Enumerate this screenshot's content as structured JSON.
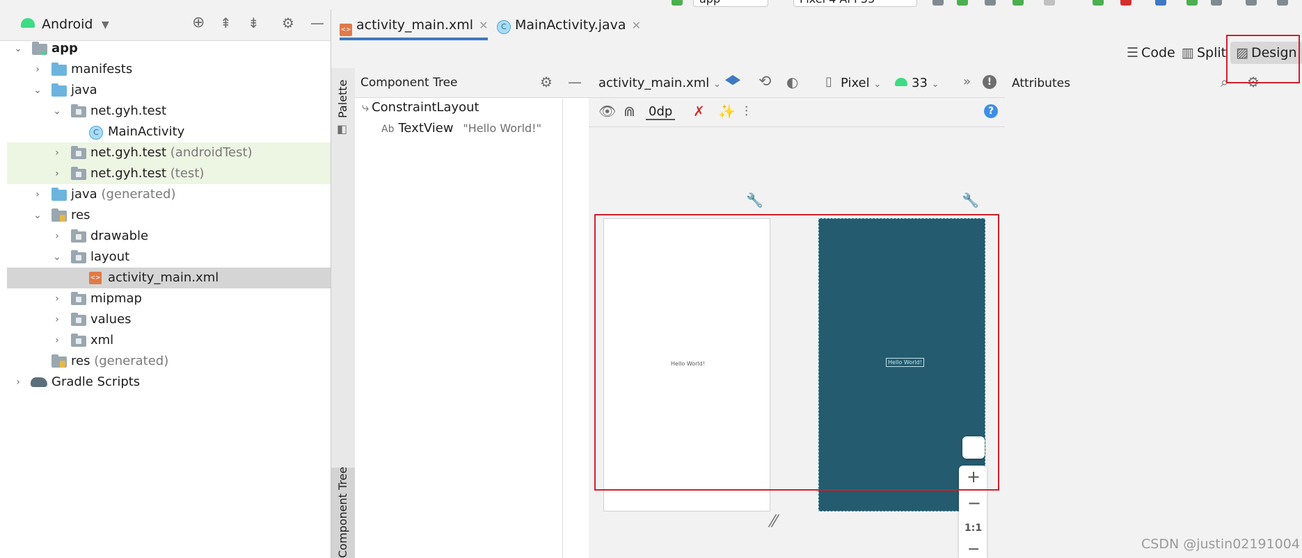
{
  "topbar": {
    "run_config": "app",
    "device": "Pixel 4 API 33"
  },
  "left_panel": {
    "view_selector": "Android",
    "tree": [
      {
        "label": "app",
        "bold": true
      },
      {
        "label": "manifests"
      },
      {
        "label": "java"
      },
      {
        "label": "net.gyh.test"
      },
      {
        "label": "MainActivity"
      },
      {
        "label": "net.gyh.test",
        "suffix": "(androidTest)"
      },
      {
        "label": "net.gyh.test",
        "suffix": "(test)"
      },
      {
        "label": "java",
        "suffix": "(generated)"
      },
      {
        "label": "res"
      },
      {
        "label": "drawable"
      },
      {
        "label": "layout"
      },
      {
        "label": "activity_main.xml"
      },
      {
        "label": "mipmap"
      },
      {
        "label": "values"
      },
      {
        "label": "xml"
      },
      {
        "label": "res",
        "suffix": "(generated)"
      },
      {
        "label": "Gradle Scripts"
      }
    ]
  },
  "editor_tabs": [
    {
      "label": "activity_main.xml",
      "active": true
    },
    {
      "label": "MainActivity.java",
      "active": false
    }
  ],
  "view_modes": {
    "code": "Code",
    "split": "Split",
    "design": "Design"
  },
  "palette_label": "Palette",
  "component_tree_side_label": "Component Tree",
  "component_tree": {
    "title": "Component Tree",
    "root": "ConstraintLayout",
    "child_type": "TextView",
    "child_prefix": "Ab",
    "child_text": "\"Hello World!\""
  },
  "design_toolbar": {
    "file": "activity_main.xml",
    "device": "Pixel",
    "api": "33",
    "margin": "0dp"
  },
  "canvas": {
    "preview_text": "Hello World!",
    "blueprint_text": "Hello World!",
    "blueprint_color": "#245b6e",
    "zoom_fit": "1:1"
  },
  "attributes": {
    "title": "Attributes"
  },
  "watermark": "CSDN @justin02191004",
  "colors": {
    "accent": "#3e79c3",
    "highlight_box": "#d21e2a",
    "android_green": "#3ddc84"
  }
}
